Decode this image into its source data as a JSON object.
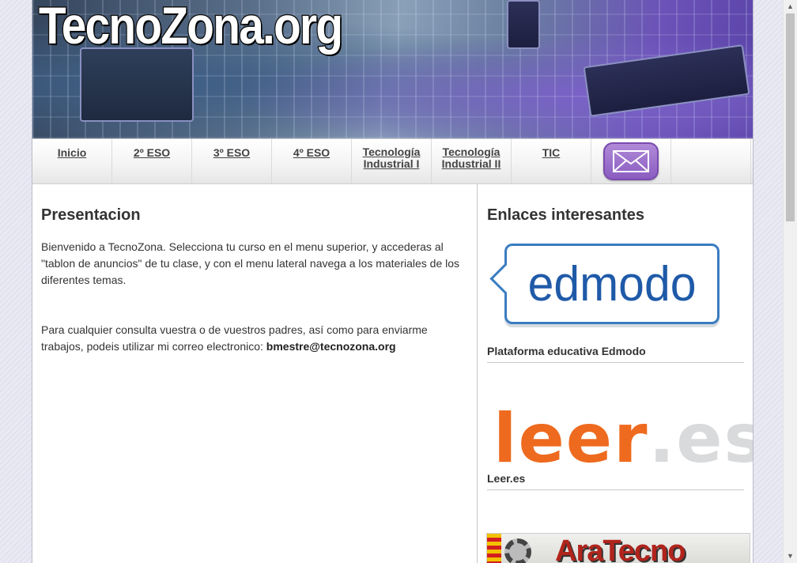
{
  "site": {
    "title": "TecnoZona.org"
  },
  "nav": {
    "items": [
      {
        "label": "Inicio"
      },
      {
        "label": "2º ESO"
      },
      {
        "label": "3º ESO"
      },
      {
        "label": "4º ESO"
      },
      {
        "label": "Tecnología\nIndustrial I"
      },
      {
        "label": "Tecnología\nIndustrial II"
      },
      {
        "label": "TIC"
      }
    ],
    "mail_icon": "envelope-icon"
  },
  "main": {
    "heading": "Presentacion",
    "intro": "Bienvenido a TecnoZona. Selecciona tu curso en el menu superior, y accederas al \"tablon de anuncios\" de tu clase, y con el menu lateral navega a los materiales de los diferentes temas.",
    "contact_text": "Para cualquier consulta vuestra o de vuestros padres, así como para enviarme trabajos, podeis utilizar mi correo electronico: ",
    "contact_email": "bmestre@tecnozona.org"
  },
  "sidebar": {
    "heading": "Enlaces interesantes",
    "links": [
      {
        "logo_text": "edmodo",
        "caption": "Plataforma educativa Edmodo"
      },
      {
        "logo_text_1": "leer",
        "logo_text_2": ".es",
        "caption": "Leer.es"
      },
      {
        "logo_text": "AraTecno"
      }
    ]
  },
  "colors": {
    "edmodo_blue": "#1f5aa8",
    "leer_orange": "#ee6a1e",
    "mail_purple": "#8a5cc0"
  }
}
